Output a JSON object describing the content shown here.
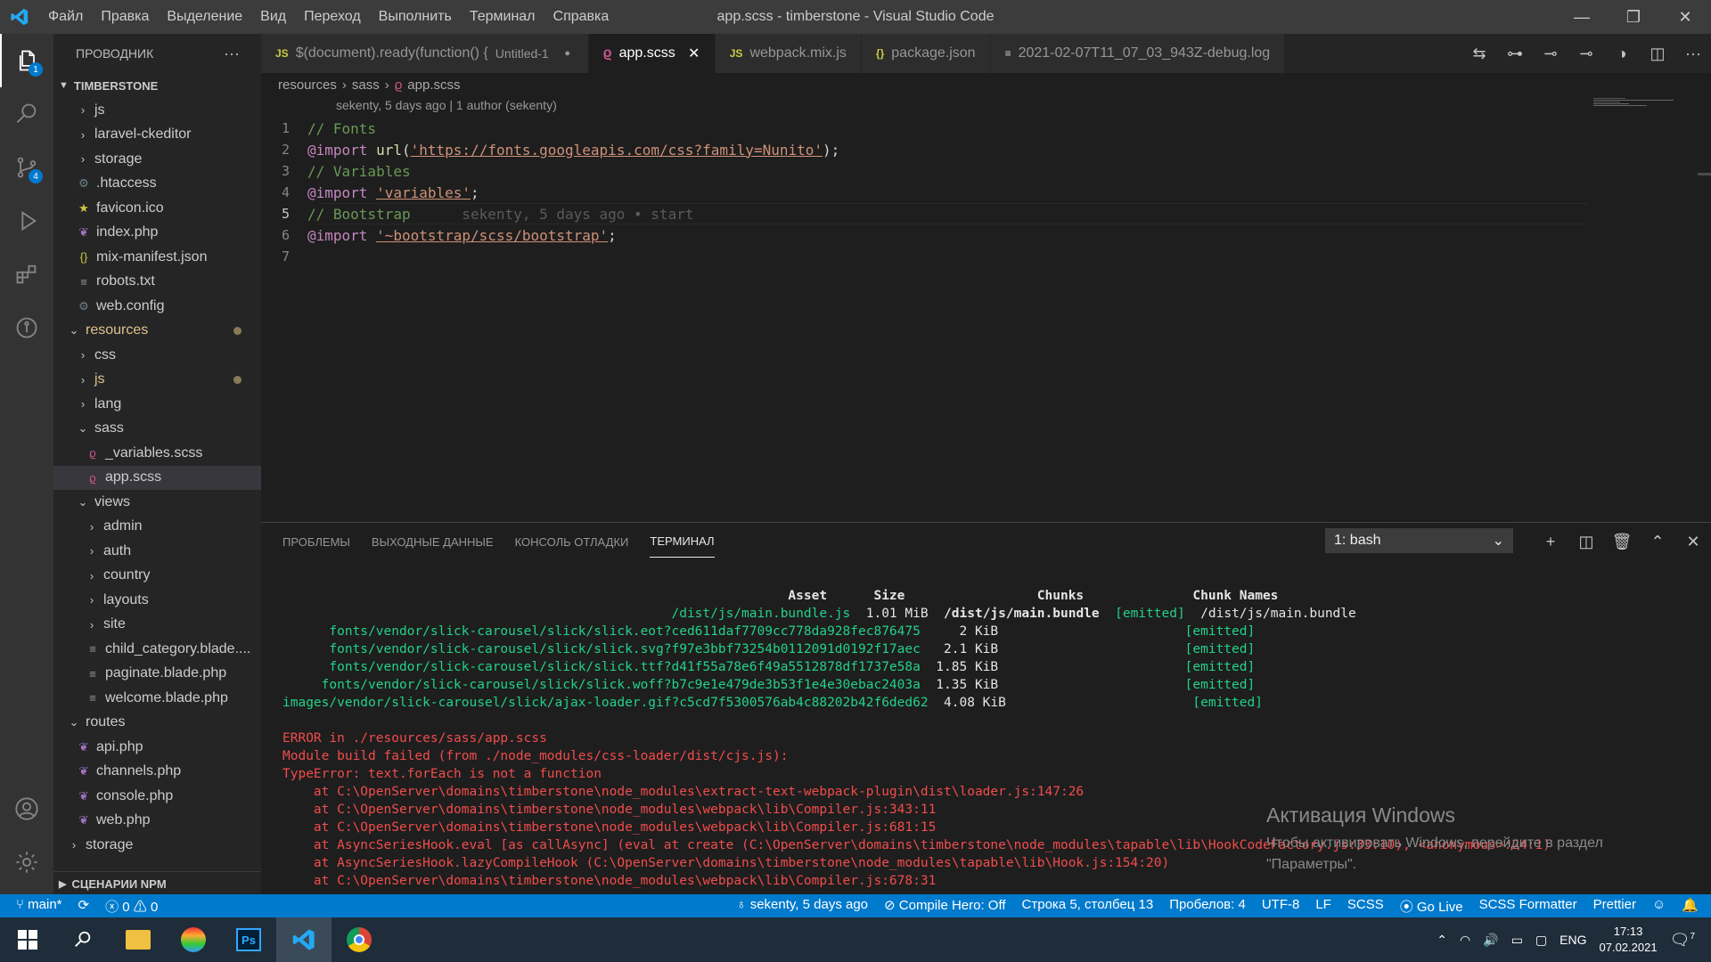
{
  "window": {
    "title": "app.scss - timberstone - Visual Studio Code"
  },
  "menu": [
    "Файл",
    "Правка",
    "Выделение",
    "Вид",
    "Переход",
    "Выполнить",
    "Терминал",
    "Справка"
  ],
  "activity": {
    "explorer_badge": "1",
    "scm_badge": "4"
  },
  "sidebar": {
    "title": "ПРОВОДНИК",
    "root": "TIMBERSTONE",
    "items": [
      {
        "label": "js",
        "kind": "folder",
        "depth": 1
      },
      {
        "label": "laravel-ckeditor",
        "kind": "folder",
        "depth": 1
      },
      {
        "label": "storage",
        "kind": "folder",
        "depth": 1
      },
      {
        "label": ".htaccess",
        "kind": "gear",
        "depth": 1
      },
      {
        "label": "favicon.ico",
        "kind": "star",
        "depth": 1
      },
      {
        "label": "index.php",
        "kind": "php",
        "depth": 1
      },
      {
        "label": "mix-manifest.json",
        "kind": "json",
        "depth": 1
      },
      {
        "label": "robots.txt",
        "kind": "txt",
        "depth": 1
      },
      {
        "label": "web.config",
        "kind": "gear",
        "depth": 1
      },
      {
        "label": "resources",
        "kind": "folder-open",
        "depth": 0,
        "modified": true
      },
      {
        "label": "css",
        "kind": "folder",
        "depth": 1
      },
      {
        "label": "js",
        "kind": "folder",
        "depth": 1,
        "modified": true
      },
      {
        "label": "lang",
        "kind": "folder",
        "depth": 1
      },
      {
        "label": "sass",
        "kind": "folder-open",
        "depth": 1
      },
      {
        "label": "_variables.scss",
        "kind": "scss",
        "depth": 2
      },
      {
        "label": "app.scss",
        "kind": "scss",
        "depth": 2,
        "selected": true
      },
      {
        "label": "views",
        "kind": "folder-open",
        "depth": 1
      },
      {
        "label": "admin",
        "kind": "folder",
        "depth": 2
      },
      {
        "label": "auth",
        "kind": "folder",
        "depth": 2
      },
      {
        "label": "country",
        "kind": "folder",
        "depth": 2
      },
      {
        "label": "layouts",
        "kind": "folder",
        "depth": 2
      },
      {
        "label": "site",
        "kind": "folder",
        "depth": 2
      },
      {
        "label": "child_category.blade....",
        "kind": "txt",
        "depth": 2
      },
      {
        "label": "paginate.blade.php",
        "kind": "txt",
        "depth": 2
      },
      {
        "label": "welcome.blade.php",
        "kind": "txt",
        "depth": 2
      },
      {
        "label": "routes",
        "kind": "folder-open",
        "depth": 0
      },
      {
        "label": "api.php",
        "kind": "php",
        "depth": 1
      },
      {
        "label": "channels.php",
        "kind": "php",
        "depth": 1
      },
      {
        "label": "console.php",
        "kind": "php",
        "depth": 1
      },
      {
        "label": "web.php",
        "kind": "php",
        "depth": 1
      },
      {
        "label": "storage",
        "kind": "folder",
        "depth": 0
      }
    ],
    "npm": "СЦЕНАРИИ NPM"
  },
  "tabs": [
    {
      "icon": "JS",
      "label": "$(document).ready(function() {",
      "suffix": "Untitled-1",
      "state": "dirty"
    },
    {
      "icon": "scss",
      "label": "app.scss",
      "state": "active"
    },
    {
      "icon": "JS",
      "label": "webpack.mix.js"
    },
    {
      "icon": "{}",
      "label": "package.json"
    },
    {
      "icon": "≡",
      "label": "2021-02-07T11_07_03_943Z-debug.log"
    }
  ],
  "breadcrumb": [
    "resources",
    "sass",
    "app.scss"
  ],
  "blame": "sekenty, 5 days ago | 1 author (sekenty)",
  "code": [
    [
      {
        "c": "cm",
        "t": "// Fonts"
      }
    ],
    [
      {
        "c": "at",
        "t": "@import"
      },
      {
        "c": "pl",
        "t": " "
      },
      {
        "c": "fn",
        "t": "url"
      },
      {
        "c": "pl",
        "t": "("
      },
      {
        "c": "st",
        "t": "'https://fonts.googleapis.com/css?family=Nunito'"
      },
      {
        "c": "pl",
        "t": ");"
      }
    ],
    [
      {
        "c": "cm",
        "t": "// Variables"
      }
    ],
    [
      {
        "c": "at",
        "t": "@import"
      },
      {
        "c": "pl",
        "t": " "
      },
      {
        "c": "st",
        "t": "'variables'"
      },
      {
        "c": "pl",
        "t": ";"
      }
    ],
    [
      {
        "c": "cm",
        "t": "// Bootstrap"
      },
      {
        "c": "gh",
        "t": "      sekenty, 5 days ago • start"
      }
    ],
    [
      {
        "c": "at",
        "t": "@import"
      },
      {
        "c": "pl",
        "t": " "
      },
      {
        "c": "st",
        "t": "'~bootstrap/scss/bootstrap'"
      },
      {
        "c": "pl",
        "t": ";"
      }
    ],
    []
  ],
  "panel": {
    "tabs": [
      "ПРОБЛЕМЫ",
      "ВЫХОДНЫЕ ДАННЫЕ",
      "КОНСОЛЬ ОТЛАДКИ",
      "ТЕРМИНАЛ"
    ],
    "active": "ТЕРМИНАЛ",
    "terminal_select": "1: bash"
  },
  "terminal": [
    {
      "s": [
        {
          "c": "thead",
          "t": "                                                                 Asset      Size                 Chunks              Chunk Names"
        }
      ]
    },
    {
      "s": [
        {
          "c": "tg",
          "t": "                                                  /dist/js/main.bundle.js"
        },
        {
          "c": "tw",
          "t": "  1.01 MiB  "
        },
        {
          "c": "twb",
          "t": "/dist/js/main.bundle"
        },
        {
          "c": "tg",
          "t": "  [emitted]"
        },
        {
          "c": "tw",
          "t": "  /dist/js/main.bundle"
        }
      ]
    },
    {
      "s": [
        {
          "c": "tg",
          "t": "      fonts/vendor/slick-carousel/slick/slick.eot?ced611daf7709cc778da928fec876475"
        },
        {
          "c": "tw",
          "t": "     2 KiB                        "
        },
        {
          "c": "tg",
          "t": "[emitted]"
        }
      ]
    },
    {
      "s": [
        {
          "c": "tg",
          "t": "      fonts/vendor/slick-carousel/slick/slick.svg?f97e3bbf73254b0112091d0192f17aec"
        },
        {
          "c": "tw",
          "t": "   2.1 KiB                        "
        },
        {
          "c": "tg",
          "t": "[emitted]"
        }
      ]
    },
    {
      "s": [
        {
          "c": "tg",
          "t": "      fonts/vendor/slick-carousel/slick/slick.ttf?d41f55a78e6f49a5512878df1737e58a"
        },
        {
          "c": "tw",
          "t": "  1.85 KiB                        "
        },
        {
          "c": "tg",
          "t": "[emitted]"
        }
      ]
    },
    {
      "s": [
        {
          "c": "tg",
          "t": "     fonts/vendor/slick-carousel/slick/slick.woff?b7c9e1e479de3b53f1e4e30ebac2403a"
        },
        {
          "c": "tw",
          "t": "  1.35 KiB                        "
        },
        {
          "c": "tg",
          "t": "[emitted]"
        }
      ]
    },
    {
      "s": [
        {
          "c": "tg",
          "t": "images/vendor/slick-carousel/slick/ajax-loader.gif?c5cd7f5300576ab4c88202b42f6ded62"
        },
        {
          "c": "tw",
          "t": "  4.08 KiB                        "
        },
        {
          "c": "tg",
          "t": "[emitted]"
        }
      ]
    },
    {
      "s": [
        {
          "c": "tw",
          "t": " "
        }
      ]
    },
    {
      "s": [
        {
          "c": "tr",
          "t": "ERROR in ./resources/sass/app.scss"
        }
      ]
    },
    {
      "s": [
        {
          "c": "tr",
          "t": "Module build failed (from ./node_modules/css-loader/dist/cjs.js):"
        }
      ]
    },
    {
      "s": [
        {
          "c": "tr",
          "t": "TypeError: text.forEach is not a function"
        }
      ]
    },
    {
      "s": [
        {
          "c": "tr",
          "t": "    at C:\\OpenServer\\domains\\timberstone\\node_modules\\extract-text-webpack-plugin\\dist\\loader.js:147:26"
        }
      ]
    },
    {
      "s": [
        {
          "c": "tr",
          "t": "    at C:\\OpenServer\\domains\\timberstone\\node_modules\\webpack\\lib\\Compiler.js:343:11"
        }
      ]
    },
    {
      "s": [
        {
          "c": "tr",
          "t": "    at C:\\OpenServer\\domains\\timberstone\\node_modules\\webpack\\lib\\Compiler.js:681:15"
        }
      ]
    },
    {
      "s": [
        {
          "c": "tr",
          "t": "    at AsyncSeriesHook.eval [as callAsync] (eval at create (C:\\OpenServer\\domains\\timberstone\\node_modules\\tapable\\lib\\HookCodeFactory.js:33:10), <anonymous>:24:1)"
        }
      ]
    },
    {
      "s": [
        {
          "c": "tr",
          "t": "    at AsyncSeriesHook.lazyCompileHook (C:\\OpenServer\\domains\\timberstone\\node_modules\\tapable\\lib\\Hook.js:154:20)"
        }
      ]
    },
    {
      "s": [
        {
          "c": "tr",
          "t": "    at C:\\OpenServer\\domains\\timberstone\\node_modules\\webpack\\lib\\Compiler.js:678:31"
        }
      ]
    }
  ],
  "activation": {
    "title": "Активация Windows",
    "line1": "Чтобы активировать Windows, перейдите в раздел",
    "line2": "\"Параметры\"."
  },
  "status": {
    "branch": "main*",
    "errors": "0",
    "warnings": "0",
    "blame": "sekenty, 5 days ago",
    "compile": "Compile Hero: Off",
    "position": "Строка 5, столбец 13",
    "spaces": "Пробелов: 4",
    "encoding": "UTF-8",
    "eol": "LF",
    "lang": "SCSS",
    "golive": "Go Live",
    "formatter": "SCSS Formatter",
    "prettier": "Prettier"
  },
  "taskbar": {
    "lang": "ENG",
    "time": "17:13",
    "date": "07.02.2021",
    "notif": "7"
  },
  "colors": {
    "accent": "#007acc",
    "error": "#f14c4c",
    "success": "#23d18b"
  }
}
